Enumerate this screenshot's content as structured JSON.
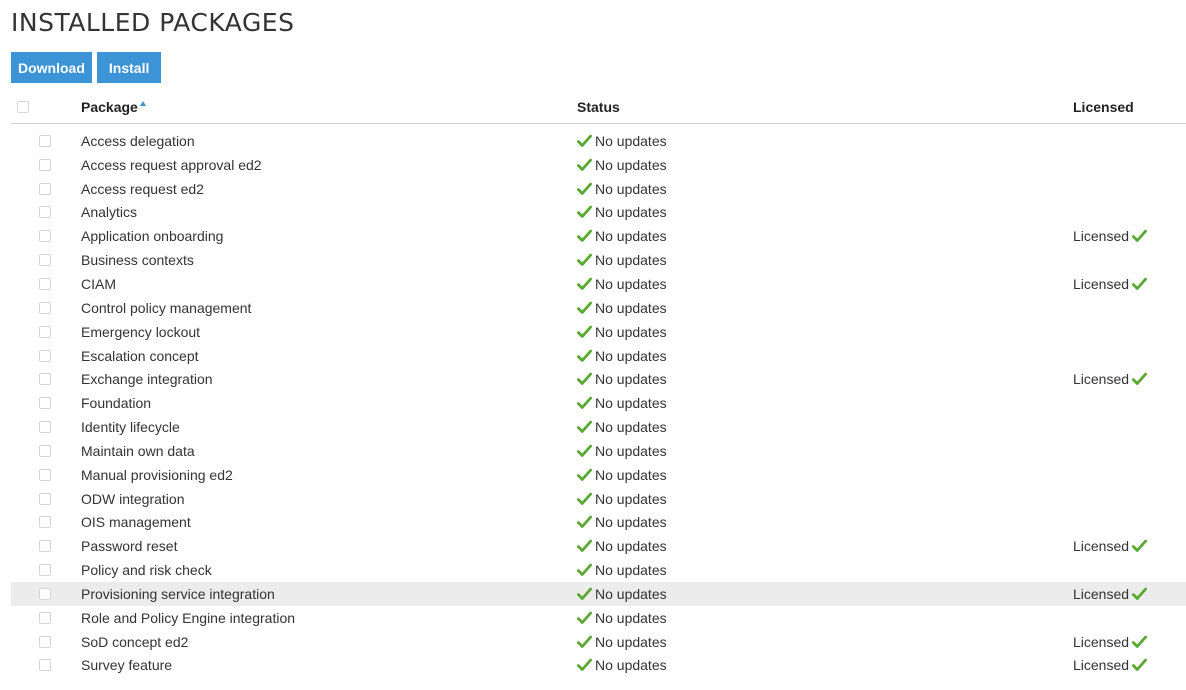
{
  "page": {
    "title": "INSTALLED PACKAGES"
  },
  "toolbar": {
    "download_label": "Download",
    "install_label": "Install"
  },
  "table": {
    "columns": {
      "package": "Package",
      "status": "Status",
      "licensed": "Licensed"
    },
    "sort": {
      "column": "Package",
      "direction": "ascending"
    },
    "rows": [
      {
        "package": "Access delegation",
        "status": "No updates",
        "licensed": ""
      },
      {
        "package": "Access request approval ed2",
        "status": "No updates",
        "licensed": ""
      },
      {
        "package": "Access request ed2",
        "status": "No updates",
        "licensed": ""
      },
      {
        "package": "Analytics",
        "status": "No updates",
        "licensed": ""
      },
      {
        "package": "Application onboarding",
        "status": "No updates",
        "licensed": "Licensed"
      },
      {
        "package": "Business contexts",
        "status": "No updates",
        "licensed": ""
      },
      {
        "package": "CIAM",
        "status": "No updates",
        "licensed": "Licensed"
      },
      {
        "package": "Control policy management",
        "status": "No updates",
        "licensed": ""
      },
      {
        "package": "Emergency lockout",
        "status": "No updates",
        "licensed": ""
      },
      {
        "package": "Escalation concept",
        "status": "No updates",
        "licensed": ""
      },
      {
        "package": "Exchange integration",
        "status": "No updates",
        "licensed": "Licensed"
      },
      {
        "package": "Foundation",
        "status": "No updates",
        "licensed": ""
      },
      {
        "package": "Identity lifecycle",
        "status": "No updates",
        "licensed": ""
      },
      {
        "package": "Maintain own data",
        "status": "No updates",
        "licensed": ""
      },
      {
        "package": "Manual provisioning ed2",
        "status": "No updates",
        "licensed": ""
      },
      {
        "package": "ODW integration",
        "status": "No updates",
        "licensed": ""
      },
      {
        "package": "OIS management",
        "status": "No updates",
        "licensed": ""
      },
      {
        "package": "Password reset",
        "status": "No updates",
        "licensed": "Licensed"
      },
      {
        "package": "Policy and risk check",
        "status": "No updates",
        "licensed": ""
      },
      {
        "package": "Provisioning service integration",
        "status": "No updates",
        "licensed": "Licensed",
        "highlighted": true
      },
      {
        "package": "Role and Policy Engine integration",
        "status": "No updates",
        "licensed": ""
      },
      {
        "package": "SoD concept ed2",
        "status": "No updates",
        "licensed": "Licensed"
      },
      {
        "package": "Survey feature",
        "status": "No updates",
        "licensed": "Licensed"
      }
    ]
  },
  "colors": {
    "accent": "#3c94d6",
    "check_green": "#5aa832",
    "row_highlight": "#ececec"
  },
  "icons": {
    "status": "check-icon",
    "licensed": "check-icon",
    "sort": "sort-ascending-icon"
  }
}
